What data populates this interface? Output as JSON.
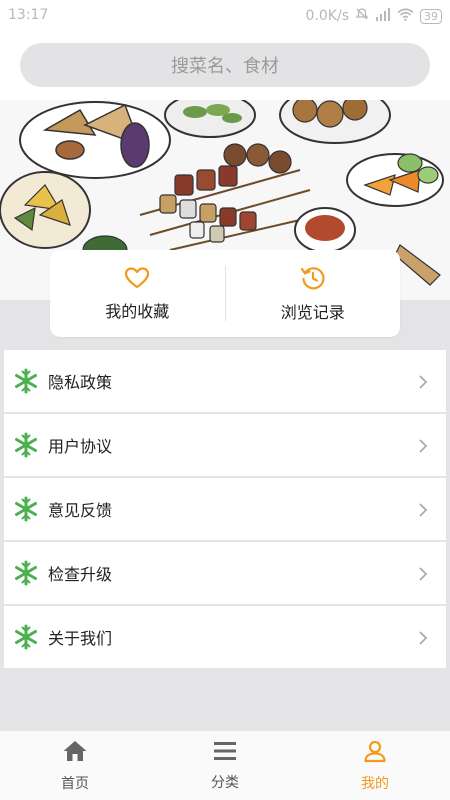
{
  "status_bar": {
    "time": "13:17",
    "network_speed": "0.0K/s",
    "battery": "39"
  },
  "search": {
    "placeholder": "搜菜名、食材"
  },
  "quick_actions": [
    {
      "label": "我的收藏",
      "icon": "heart-icon"
    },
    {
      "label": "浏览记录",
      "icon": "history-icon"
    }
  ],
  "menu": {
    "items": [
      {
        "label": "隐私政策",
        "icon": "snowflake-icon"
      },
      {
        "label": "用户协议",
        "icon": "snowflake-icon"
      },
      {
        "label": "意见反馈",
        "icon": "snowflake-icon"
      },
      {
        "label": "检查升级",
        "icon": "snowflake-icon"
      },
      {
        "label": "关于我们",
        "icon": "snowflake-icon"
      }
    ]
  },
  "bottom_nav": {
    "items": [
      {
        "label": "首页",
        "icon": "home-icon"
      },
      {
        "label": "分类",
        "icon": "menu-lines-icon"
      },
      {
        "label": "我的",
        "icon": "user-icon",
        "active": true
      }
    ]
  },
  "colors": {
    "accent": "#f29b1b",
    "menu_icon": "#4caf50"
  }
}
